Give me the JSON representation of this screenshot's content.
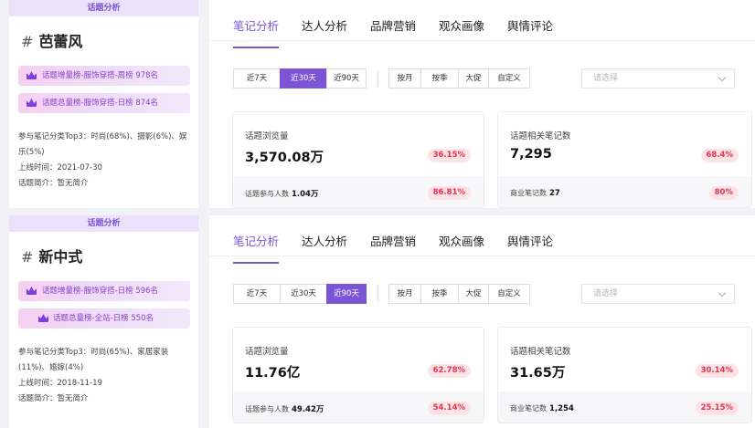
{
  "panels": [
    {
      "header": "话题分析",
      "topic_hash": "#",
      "topic": "芭蕾风",
      "ranks": [
        "话题增量榜-服饰穿搭-周榜 978名",
        "话题总量榜-服饰穿搭-日榜 874名"
      ],
      "categories": "参与笔记分类Top3：时尚(68%)、摄影(6%)、娱乐(5%)",
      "online": "上线时间：2021-07-30",
      "intro": "话题简介：暂无简介",
      "tabs": [
        "笔记分析",
        "达人分析",
        "品牌营销",
        "观众画像",
        "舆情评论"
      ],
      "active_tab": "笔记分析",
      "time_buttons": [
        "近7天",
        "近30天",
        "近90天"
      ],
      "selected_time": "近30天",
      "period_buttons": [
        "按月",
        "按季",
        "大促",
        "自定义"
      ],
      "select_placeholder": "请选择",
      "cards": [
        {
          "label": "话题浏览量",
          "value": "3,570.08万",
          "pct": "36.15%",
          "sub_label": "话题参与人数",
          "sub_value": "1.04万",
          "sub_pct": "86.81%"
        },
        {
          "label": "话题相关笔记数",
          "value": "7,295",
          "pct": "68.4%",
          "sub_label": "商业笔记数",
          "sub_value": "27",
          "sub_pct": "80%"
        }
      ]
    },
    {
      "header": "话题分析",
      "topic_hash": "#",
      "topic": "新中式",
      "ranks": [
        "话题增量榜-服饰穿搭-日榜 596名",
        "话题总量榜-全站-日榜 550名"
      ],
      "categories": "参与笔记分类Top3：时尚(65%)、家居家装(11%)、婚嫁(4%)",
      "online": "上线时间：2018-11-19",
      "intro": "话题简介：暂无简介",
      "tabs": [
        "笔记分析",
        "达人分析",
        "品牌营销",
        "观众画像",
        "舆情评论"
      ],
      "active_tab": "笔记分析",
      "time_buttons": [
        "近7天",
        "近30天",
        "近90天"
      ],
      "selected_time": "近90天",
      "period_buttons": [
        "按月",
        "按季",
        "大促",
        "自定义"
      ],
      "select_placeholder": "请选择",
      "cards": [
        {
          "label": "话题浏览量",
          "value": "11.76亿",
          "pct": "62.78%",
          "sub_label": "话题参与人数",
          "sub_value": "49.42万",
          "sub_pct": "54.14%"
        },
        {
          "label": "话题相关笔记数",
          "value": "31.65万",
          "pct": "30.14%",
          "sub_label": "商业笔记数",
          "sub_value": "1,254",
          "sub_pct": "25.15%"
        }
      ]
    }
  ],
  "colors": {
    "accent": "#7b55d6",
    "negative": "#e8344e",
    "badge_bg": "#fde3e6",
    "header_bg": "#ebe1fb"
  }
}
